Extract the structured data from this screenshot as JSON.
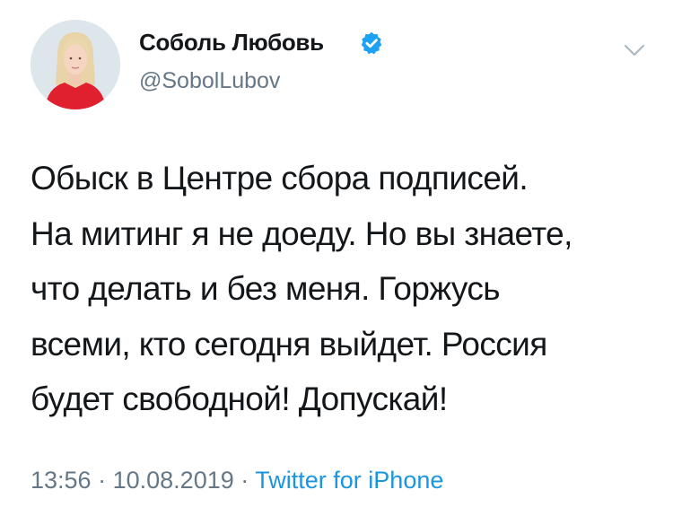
{
  "tweet": {
    "author": {
      "name": "Соболь Любовь",
      "handle": "@SobolLubov",
      "verified": true,
      "avatar_icon": "user-avatar-photo"
    },
    "text": "Обыск в Центре сбора подписей.\nНа митинг я не доеду. Но вы знаете,\nчто делать и без меня. Горжусь\nвсеми, кто сегодня выйдет. Россия\nбудет свободной! Допускай!",
    "meta": {
      "time": "13:56",
      "separator": "·",
      "date": "10.08.2019",
      "source": "Twitter for iPhone"
    },
    "menu_icon": "chevron-down-icon"
  },
  "colors": {
    "text_primary": "#14171a",
    "text_secondary": "#657786",
    "link": "#1b95e0",
    "verified_badge": "#1da1f2"
  }
}
